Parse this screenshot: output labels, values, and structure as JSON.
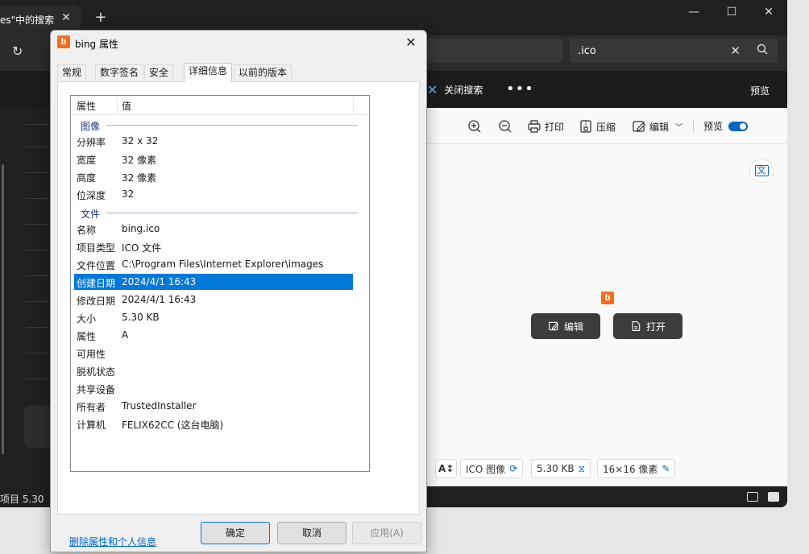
{
  "explorer": {
    "tab_title": "es\"中的搜索",
    "search_value": ".ico",
    "close_search_label": "关闭搜索",
    "more_label": "•••",
    "preview_pane_label": "预览",
    "status_text": "项目  5.30"
  },
  "preview": {
    "toolbar": {
      "print_label": "打印",
      "compress_label": "压缩",
      "edit_label": "编辑",
      "preview_toggle_label": "预览"
    },
    "translate_label": "文",
    "edit_button_label": "编辑",
    "open_button_label": "打开",
    "chips": {
      "type": "ICO 图像",
      "size": "5.30 KB",
      "dimensions": "16×16 像素"
    }
  },
  "dialog": {
    "title": "bing 属性",
    "tabs": [
      "常规",
      "数字签名",
      "安全",
      "详细信息",
      "以前的版本"
    ],
    "active_tab": "详细信息",
    "columns": [
      "属性",
      "值"
    ],
    "groups": [
      {
        "label": "图像",
        "rows": [
          {
            "name": "分辨率",
            "value": "32 x 32"
          },
          {
            "name": "宽度",
            "value": "32 像素"
          },
          {
            "name": "高度",
            "value": "32 像素"
          },
          {
            "name": "位深度",
            "value": "32"
          }
        ]
      },
      {
        "label": "文件",
        "rows": [
          {
            "name": "名称",
            "value": "bing.ico"
          },
          {
            "name": "项目类型",
            "value": "ICO 文件"
          },
          {
            "name": "文件位置",
            "value": "C:\\Program Files\\Internet Explorer\\images"
          },
          {
            "name": "创建日期",
            "value": "2024/4/1 16:43",
            "selected": true
          },
          {
            "name": "修改日期",
            "value": "2024/4/1 16:43"
          },
          {
            "name": "大小",
            "value": "5.30 KB"
          },
          {
            "name": "属性",
            "value": "A"
          },
          {
            "name": "可用性",
            "value": ""
          },
          {
            "name": "脱机状态",
            "value": ""
          },
          {
            "name": "共享设备",
            "value": ""
          },
          {
            "name": "所有者",
            "value": "TrustedInstaller"
          },
          {
            "name": "计算机",
            "value": "FELIX62CC (这台电脑)"
          }
        ]
      }
    ],
    "remove_link": "删除属性和个人信息",
    "buttons": {
      "ok": "确定",
      "cancel": "取消",
      "apply": "应用(A)"
    }
  },
  "colors": {
    "accent": "#0078d7",
    "bing_orange": "#f07021",
    "dark_bg": "#202020"
  }
}
